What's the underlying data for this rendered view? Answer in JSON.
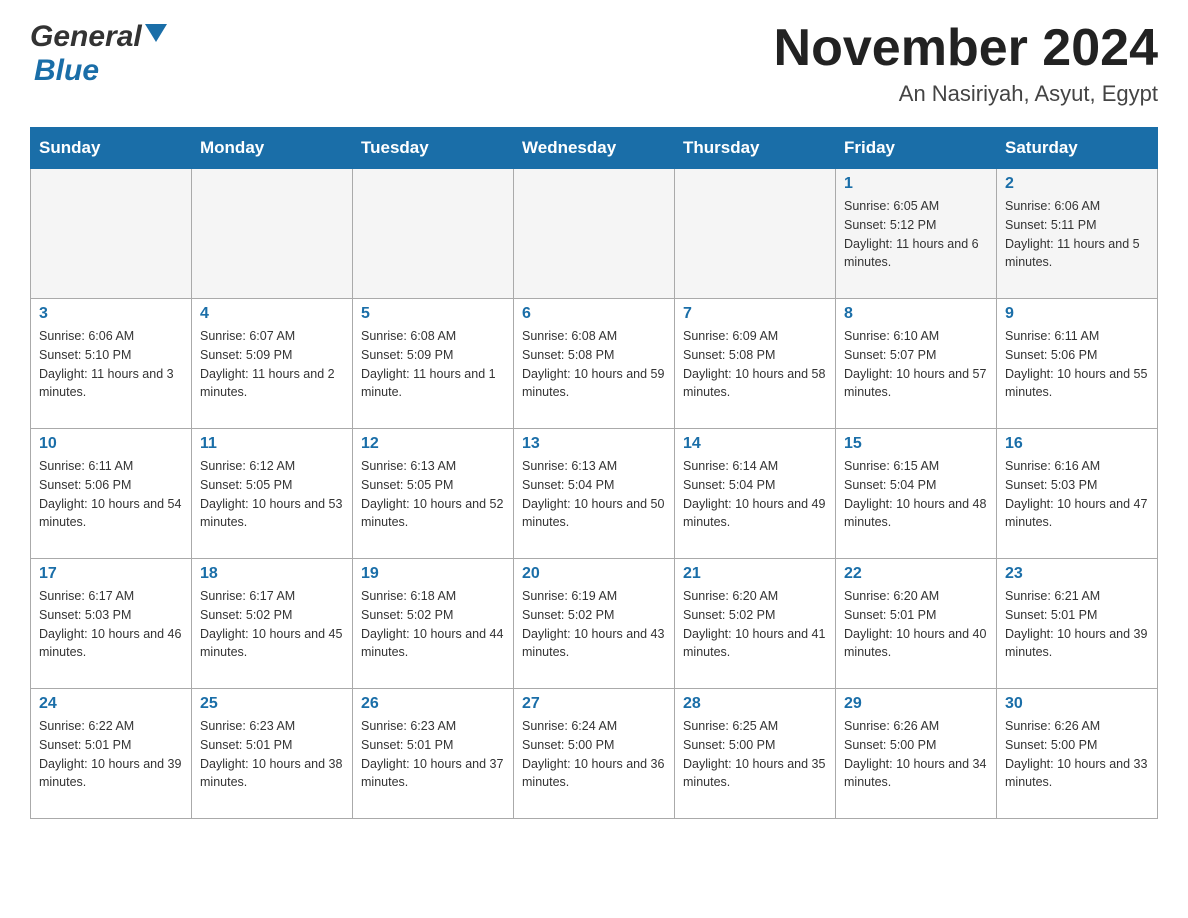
{
  "header": {
    "logo_general": "General",
    "logo_blue": "Blue",
    "month_title": "November 2024",
    "location": "An Nasiriyah, Asyut, Egypt"
  },
  "weekdays": [
    "Sunday",
    "Monday",
    "Tuesday",
    "Wednesday",
    "Thursday",
    "Friday",
    "Saturday"
  ],
  "weeks": [
    [
      {
        "day": "",
        "info": ""
      },
      {
        "day": "",
        "info": ""
      },
      {
        "day": "",
        "info": ""
      },
      {
        "day": "",
        "info": ""
      },
      {
        "day": "",
        "info": ""
      },
      {
        "day": "1",
        "info": "Sunrise: 6:05 AM\nSunset: 5:12 PM\nDaylight: 11 hours and 6 minutes."
      },
      {
        "day": "2",
        "info": "Sunrise: 6:06 AM\nSunset: 5:11 PM\nDaylight: 11 hours and 5 minutes."
      }
    ],
    [
      {
        "day": "3",
        "info": "Sunrise: 6:06 AM\nSunset: 5:10 PM\nDaylight: 11 hours and 3 minutes."
      },
      {
        "day": "4",
        "info": "Sunrise: 6:07 AM\nSunset: 5:09 PM\nDaylight: 11 hours and 2 minutes."
      },
      {
        "day": "5",
        "info": "Sunrise: 6:08 AM\nSunset: 5:09 PM\nDaylight: 11 hours and 1 minute."
      },
      {
        "day": "6",
        "info": "Sunrise: 6:08 AM\nSunset: 5:08 PM\nDaylight: 10 hours and 59 minutes."
      },
      {
        "day": "7",
        "info": "Sunrise: 6:09 AM\nSunset: 5:08 PM\nDaylight: 10 hours and 58 minutes."
      },
      {
        "day": "8",
        "info": "Sunrise: 6:10 AM\nSunset: 5:07 PM\nDaylight: 10 hours and 57 minutes."
      },
      {
        "day": "9",
        "info": "Sunrise: 6:11 AM\nSunset: 5:06 PM\nDaylight: 10 hours and 55 minutes."
      }
    ],
    [
      {
        "day": "10",
        "info": "Sunrise: 6:11 AM\nSunset: 5:06 PM\nDaylight: 10 hours and 54 minutes."
      },
      {
        "day": "11",
        "info": "Sunrise: 6:12 AM\nSunset: 5:05 PM\nDaylight: 10 hours and 53 minutes."
      },
      {
        "day": "12",
        "info": "Sunrise: 6:13 AM\nSunset: 5:05 PM\nDaylight: 10 hours and 52 minutes."
      },
      {
        "day": "13",
        "info": "Sunrise: 6:13 AM\nSunset: 5:04 PM\nDaylight: 10 hours and 50 minutes."
      },
      {
        "day": "14",
        "info": "Sunrise: 6:14 AM\nSunset: 5:04 PM\nDaylight: 10 hours and 49 minutes."
      },
      {
        "day": "15",
        "info": "Sunrise: 6:15 AM\nSunset: 5:04 PM\nDaylight: 10 hours and 48 minutes."
      },
      {
        "day": "16",
        "info": "Sunrise: 6:16 AM\nSunset: 5:03 PM\nDaylight: 10 hours and 47 minutes."
      }
    ],
    [
      {
        "day": "17",
        "info": "Sunrise: 6:17 AM\nSunset: 5:03 PM\nDaylight: 10 hours and 46 minutes."
      },
      {
        "day": "18",
        "info": "Sunrise: 6:17 AM\nSunset: 5:02 PM\nDaylight: 10 hours and 45 minutes."
      },
      {
        "day": "19",
        "info": "Sunrise: 6:18 AM\nSunset: 5:02 PM\nDaylight: 10 hours and 44 minutes."
      },
      {
        "day": "20",
        "info": "Sunrise: 6:19 AM\nSunset: 5:02 PM\nDaylight: 10 hours and 43 minutes."
      },
      {
        "day": "21",
        "info": "Sunrise: 6:20 AM\nSunset: 5:02 PM\nDaylight: 10 hours and 41 minutes."
      },
      {
        "day": "22",
        "info": "Sunrise: 6:20 AM\nSunset: 5:01 PM\nDaylight: 10 hours and 40 minutes."
      },
      {
        "day": "23",
        "info": "Sunrise: 6:21 AM\nSunset: 5:01 PM\nDaylight: 10 hours and 39 minutes."
      }
    ],
    [
      {
        "day": "24",
        "info": "Sunrise: 6:22 AM\nSunset: 5:01 PM\nDaylight: 10 hours and 39 minutes."
      },
      {
        "day": "25",
        "info": "Sunrise: 6:23 AM\nSunset: 5:01 PM\nDaylight: 10 hours and 38 minutes."
      },
      {
        "day": "26",
        "info": "Sunrise: 6:23 AM\nSunset: 5:01 PM\nDaylight: 10 hours and 37 minutes."
      },
      {
        "day": "27",
        "info": "Sunrise: 6:24 AM\nSunset: 5:00 PM\nDaylight: 10 hours and 36 minutes."
      },
      {
        "day": "28",
        "info": "Sunrise: 6:25 AM\nSunset: 5:00 PM\nDaylight: 10 hours and 35 minutes."
      },
      {
        "day": "29",
        "info": "Sunrise: 6:26 AM\nSunset: 5:00 PM\nDaylight: 10 hours and 34 minutes."
      },
      {
        "day": "30",
        "info": "Sunrise: 6:26 AM\nSunset: 5:00 PM\nDaylight: 10 hours and 33 minutes."
      }
    ]
  ]
}
